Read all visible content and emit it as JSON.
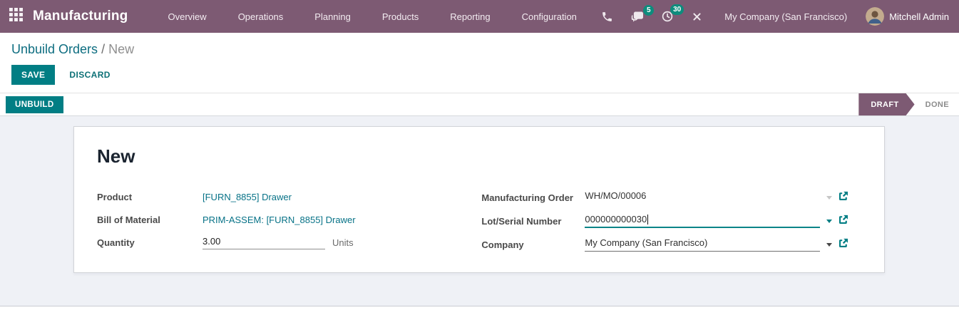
{
  "navbar": {
    "app_name": "Manufacturing",
    "menus": [
      "Overview",
      "Operations",
      "Planning",
      "Products",
      "Reporting",
      "Configuration"
    ],
    "messages_badge": "5",
    "activities_badge": "30",
    "company": "My Company (San Francisco)",
    "user": "Mitchell Admin"
  },
  "breadcrumb": {
    "parent": "Unbuild Orders",
    "separator": " / ",
    "current": "New"
  },
  "actions": {
    "save": "SAVE",
    "discard": "DISCARD"
  },
  "statusbar": {
    "unbuild": "UNBUILD",
    "state_active": "DRAFT",
    "state_done": "DONE"
  },
  "form": {
    "title": "New",
    "product": {
      "label": "Product",
      "value": "[FURN_8855] Drawer"
    },
    "bom": {
      "label": "Bill of Material",
      "value": "PRIM-ASSEM: [FURN_8855] Drawer"
    },
    "quantity": {
      "label": "Quantity",
      "value": "3.00",
      "uom": "Units"
    },
    "mo": {
      "label": "Manufacturing Order",
      "value": "WH/MO/00006"
    },
    "lot": {
      "label": "Lot/Serial Number",
      "value": "000000000030"
    },
    "company": {
      "label": "Company",
      "value": "My Company (San Francisco)"
    }
  },
  "icons": {
    "apps": "3x3 grid",
    "phone": "phone-receiver",
    "messages": "chat-bubble",
    "activities": "clock",
    "tools": "crossed-tools",
    "caret": "caret-down",
    "external": "external-link-box-arrow"
  },
  "colors": {
    "navbar": "#7d5a73",
    "primary_teal": "#017e84",
    "badge_teal": "#0e8c7d",
    "state_active": "#7d5a73",
    "content_bg": "#eff1f6",
    "link": "#077287"
  }
}
